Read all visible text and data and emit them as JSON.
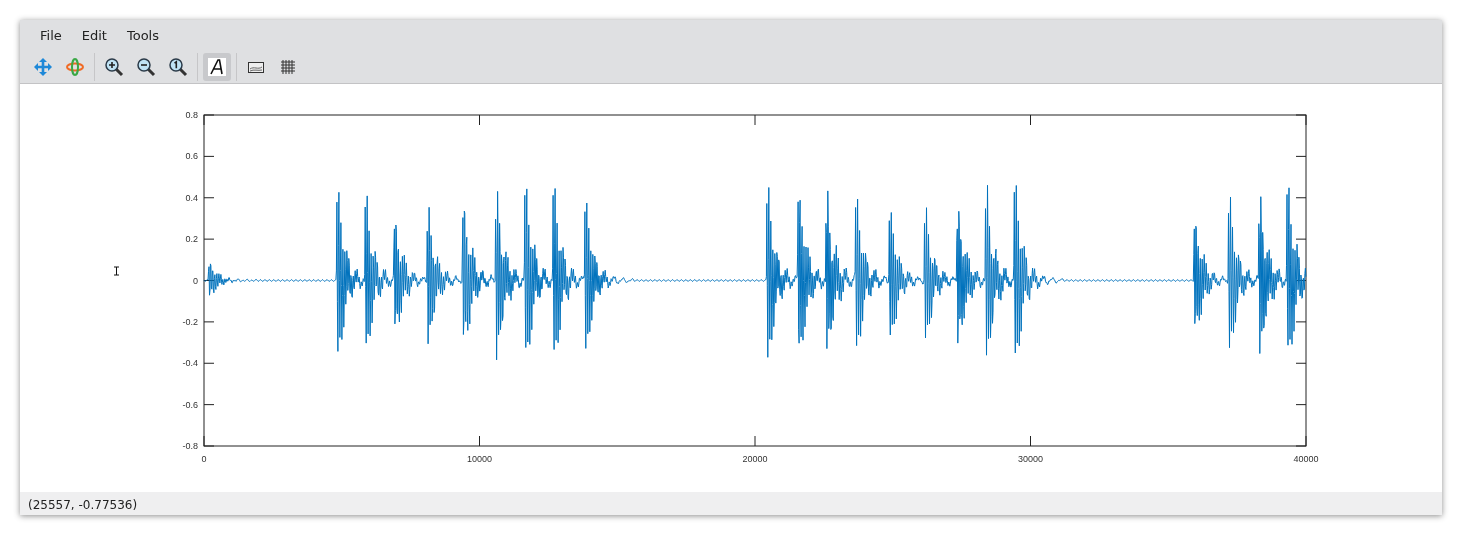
{
  "menu": [
    {
      "label": "File"
    },
    {
      "label": "Edit"
    },
    {
      "label": "Tools"
    }
  ],
  "toolbar_groups": [
    {
      "buttons": [
        {
          "kind": "pan",
          "selected": false
        },
        {
          "kind": "rotate",
          "selected": false
        }
      ]
    },
    {
      "buttons": [
        {
          "kind": "zoom-in",
          "selected": false
        },
        {
          "kind": "zoom-out",
          "selected": false
        },
        {
          "kind": "zoom-reset",
          "selected": false
        }
      ]
    },
    {
      "buttons": [
        {
          "kind": "text",
          "selected": true
        }
      ]
    },
    {
      "buttons": [
        {
          "kind": "legend",
          "selected": false
        },
        {
          "kind": "grid",
          "selected": false
        }
      ]
    }
  ],
  "plot": {
    "chart_data": {
      "type": "line",
      "xlim": [
        0,
        40000
      ],
      "ylim": [
        -0.8,
        0.8
      ],
      "xticks": [
        0,
        10000,
        20000,
        30000,
        40000
      ],
      "yticks": [
        -0.8,
        -0.6,
        -0.4,
        -0.2,
        0,
        0.2,
        0.4,
        0.6,
        0.8
      ]
    }
  },
  "status_bar": "(25557, -0.77536)"
}
